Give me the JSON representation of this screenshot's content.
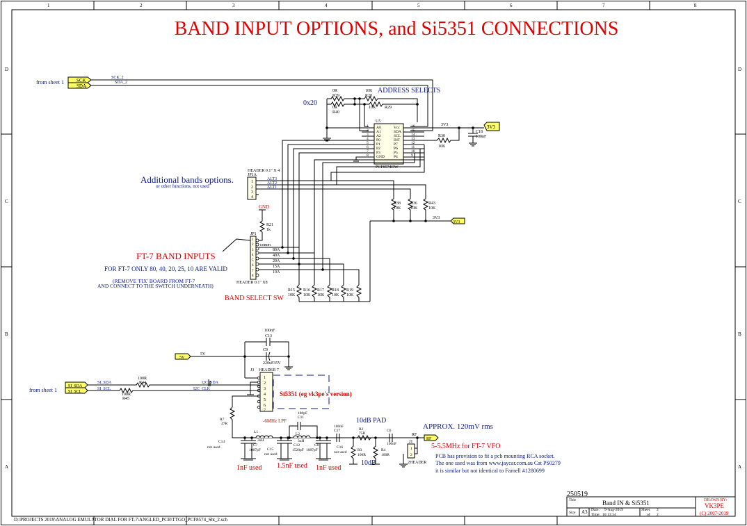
{
  "title": "BAND INPUT OPTIONS,  and Si5351 CONNECTIONS",
  "border": {
    "cols": [
      "1",
      "2",
      "3",
      "4",
      "5",
      "6",
      "7",
      "8"
    ],
    "rows": [
      "D",
      "C",
      "B",
      "A"
    ]
  },
  "ports": {
    "sck": "SCK",
    "sda": "SDA",
    "si_sda": "SI_SDA",
    "si_scl": "SI_SCL",
    "v5": "5V",
    "v3a": "3V3",
    "v3b": "3V3",
    "rf": "RF"
  },
  "nets": {
    "sck2": "SCK_2",
    "sda2": "SDA_2",
    "si_sda": "SI_SDA",
    "si_scl": "SI_SCL",
    "i2c_sda": "I2C_SDA",
    "i2c_clk": "I2C_CLK",
    "v3": "3V3",
    "v5": "5V",
    "rf": "RF",
    "alt3": "ALT3",
    "alt2": "ALT2",
    "alt1": "ALT1",
    "gnd": "GND",
    "common": "comm",
    "b80": "80A",
    "b40": "40A",
    "b20": "20A",
    "b15": "15A",
    "b10": "10A"
  },
  "notes": {
    "from_sheet1_a": "from sheet 1",
    "from_sheet1_b": "from sheet 1",
    "address_selects": "ADDRESS SELECTS",
    "addr": "0x20",
    "additional": "Additional bands options.",
    "other_functions": "or other functions, not used",
    "ft7_inputs": "FT-7 BAND INPUTS",
    "ft7_only": "FOR FT-7 ONLY 80, 40, 20, 25, 10 ARE VALID",
    "remove_fix": "(REMOVE 'FIX' BOARD FROM FT-7",
    "connect_switch": "AND CONNECT TO THE SWITCH UNDERNEATH)",
    "band_select": "BAND SELECT SW",
    "si5351": "Si5351 (eg vk3pe's version)",
    "lpf": "-6MHz LPF",
    "pad10": "10dB PAD",
    "pad10b": "10dB",
    "approx": "APPROX. 120mV rms",
    "vfo": "5-5.5MHz for FT-7 VFO",
    "pcb1": "PCB has provision to fit a pcb mounting RCA socket.",
    "pcb2": "The one used was from www.jaycar.com.au Cat PS0279",
    "pcb3": "it is similar but not identical to Farnell #1280699",
    "inf1": "1nF used",
    "inf15": "1.5nF used",
    "inf2": "1nF used",
    "path": "D:\\PROJECTS 2019\\ANALOG EMULATOR DIAL FOR FT-7\\ANGLED_PCB\\TTGO_PCF8574_Sht_2.sch"
  },
  "components": {
    "u5": {
      "ref": "U5",
      "part": "PCF8574DW",
      "pins_l": [
        "A0",
        "A1",
        "A2",
        "P0",
        "P1",
        "P2",
        "P3",
        "GND"
      ],
      "pins_r": [
        "Vcc",
        "SDA",
        "SCL",
        "INT",
        "P7",
        "P6",
        "P5",
        "P4"
      ],
      "nums_l": [
        "1",
        "2",
        "3",
        "4",
        "5",
        "6",
        "7",
        "8"
      ],
      "nums_r": [
        "16",
        "15",
        "14",
        "13",
        "12",
        "11",
        "10",
        "9"
      ]
    },
    "jp1a": {
      "ref": "JP1A",
      "part": "HEADER 0.1\" X 4",
      "pins": [
        "1",
        "2",
        "3",
        "4"
      ]
    },
    "jp1": {
      "ref": "JP1",
      "part": "HEADER 0.1\" X8",
      "pins": [
        "1",
        "2",
        "3",
        "4",
        "5",
        "6",
        "7",
        "8"
      ]
    },
    "j3": {
      "ref": "J3",
      "part": "HEADER 7",
      "pins": [
        "1",
        "2",
        "3",
        "4",
        "5",
        "6",
        "7"
      ]
    },
    "j1": {
      "ref": "J1",
      "part": "2HEADER",
      "pins": [
        "1",
        "2"
      ]
    },
    "r39": {
      "ref": "R39",
      "val": "0R"
    },
    "r40": {
      "ref": "R40",
      "val": "0R"
    },
    "r28": {
      "ref": "R28",
      "val": "10K"
    },
    "r29": {
      "ref": "R29",
      "val": "10K"
    },
    "r30": {
      "ref": "R30",
      "val": "10K"
    },
    "c18": {
      "ref": "C18",
      "val": "100nF"
    },
    "r38": {
      "ref": "R38",
      "val": "10K"
    },
    "r36": {
      "ref": "R36",
      "val": "10K"
    },
    "r43": {
      "ref": "R43",
      "val": "10K"
    },
    "r21": {
      "ref": "R21",
      "val": "1k"
    },
    "r15": {
      "ref": "R15",
      "val": "10K"
    },
    "r16": {
      "ref": "R16",
      "val": "10K"
    },
    "r17": {
      "ref": "R17",
      "val": "10K"
    },
    "r18": {
      "ref": "R18",
      "val": "10K"
    },
    "r19": {
      "ref": "R19",
      "val": "10K"
    },
    "c13": {
      "ref": "C13",
      "val": "100nF"
    },
    "c9": {
      "ref": "C9",
      "val": "220uF35V"
    },
    "r44": {
      "ref": "R44",
      "val": "100R"
    },
    "r45": {
      "ref": "R45",
      "val": "100R"
    },
    "r7": {
      "ref": "R7",
      "val": "47R"
    },
    "c14": {
      "ref": "C14",
      "val": "not used"
    },
    "l1": {
      "ref": "L1",
      "val": "3uH"
    },
    "c7": {
      "ref": "C7",
      "val": "1087pF"
    },
    "c15": {
      "ref": "C15",
      "val": "not used"
    },
    "c11": {
      "ref": "C11",
      "val": "180pF"
    },
    "l2": {
      "ref": "L2",
      "val": "3uH"
    },
    "c12": {
      "ref": "C12",
      "val": "1528pF"
    },
    "c8": {
      "ref": "C8",
      "val": "1087pF"
    },
    "c16": {
      "ref": "C16",
      "val": "not used"
    },
    "c17": {
      "ref": "C17",
      "val": "100nF"
    },
    "r2": {
      "ref": "R2",
      "val": "75R"
    },
    "r3": {
      "ref": "R3",
      "val": "100R"
    },
    "r4": {
      "ref": "R4",
      "val": "100R"
    },
    "c6": {
      "ref": "C6",
      "val": "100nF"
    }
  },
  "titleblock": {
    "date_code": "250519",
    "title_label": "Title",
    "title": "Band IN & Si5351",
    "size_label": "Size",
    "size": "A3",
    "date_label": "Date:",
    "date": "9-Aug-2019",
    "time_label": "Time:",
    "time": "10:13:34",
    "sheet_label": "Sheet",
    "sheet": "2",
    "of_label": "of",
    "of": "2",
    "drawn_label": "DRAWN BY:",
    "drawn": "VK3PE",
    "copyright": "(C) 2007-2019"
  }
}
